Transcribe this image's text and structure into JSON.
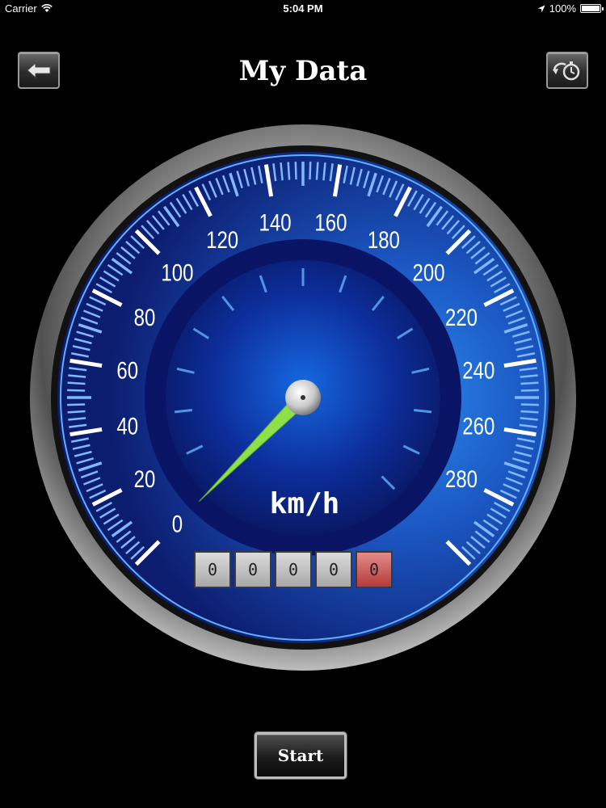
{
  "status_bar": {
    "carrier": "Carrier",
    "time": "5:04 PM",
    "battery": "100%"
  },
  "header": {
    "title": "My Data"
  },
  "speedometer": {
    "unit": "km/h",
    "min": 0,
    "max": 300,
    "current_speed": 0,
    "tick_labels": [
      "0",
      "20",
      "40",
      "60",
      "80",
      "100",
      "120",
      "140",
      "160",
      "180",
      "200",
      "220",
      "240",
      "260",
      "280"
    ],
    "needle_color": "#8ee04a",
    "accent_color": "#1f6fd6"
  },
  "odometer": {
    "digits": [
      "0",
      "0",
      "0",
      "0",
      "0"
    ]
  },
  "controls": {
    "start_label": "Start"
  }
}
